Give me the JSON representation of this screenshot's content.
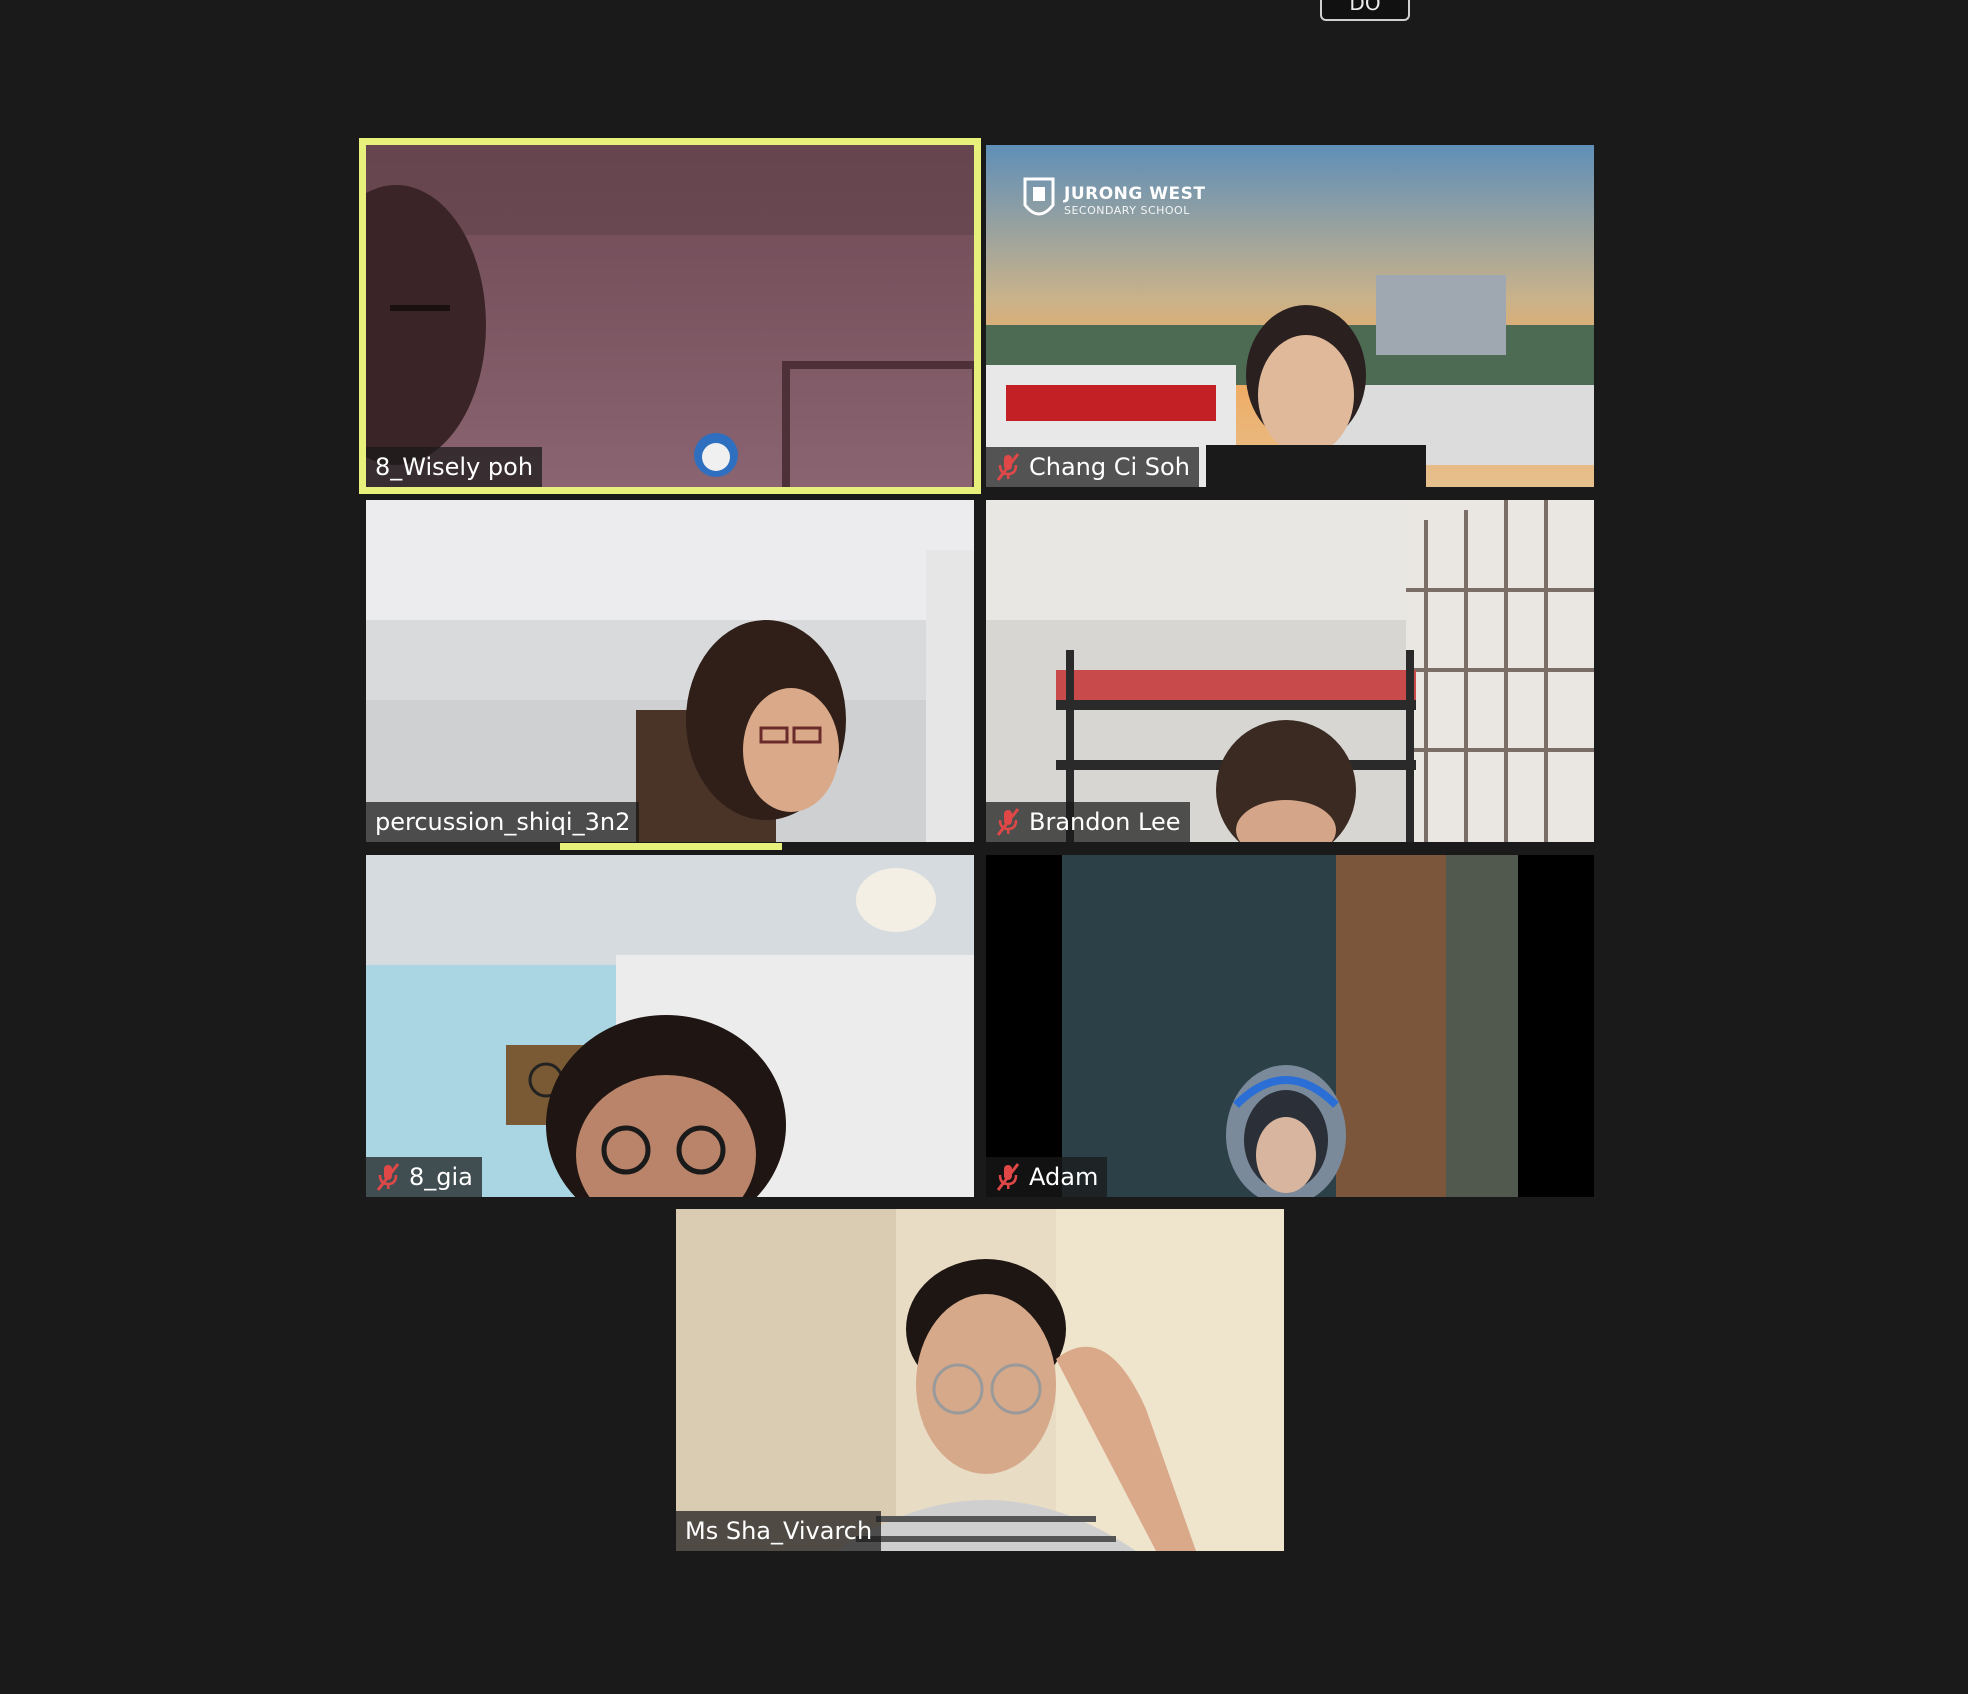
{
  "top_button": {
    "label": "DO"
  },
  "participants": [
    {
      "name": "8_Wisely poh",
      "muted": false,
      "active_speaker": true
    },
    {
      "name": "Chang Ci Soh",
      "muted": true,
      "active_speaker": false
    },
    {
      "name": "percussion_shiqi_3n2",
      "muted": false,
      "active_speaker": false
    },
    {
      "name": "Brandon Lee",
      "muted": true,
      "active_speaker": false
    },
    {
      "name": "8_gia",
      "muted": true,
      "active_speaker": false
    },
    {
      "name": "Adam",
      "muted": true,
      "active_speaker": false
    },
    {
      "name": "Ms Sha_Vivarch",
      "muted": false,
      "active_speaker": false
    }
  ],
  "virtual_background": {
    "line1": "JURONG WEST",
    "line2": "SECONDARY SCHOOL"
  },
  "colors": {
    "background": "#1a1a1a",
    "active_outline": "#e7f07a",
    "mute_icon": "#e04848",
    "name_tag_text": "#ffffff"
  },
  "icons": {
    "muted": "microphone-muted-icon"
  }
}
